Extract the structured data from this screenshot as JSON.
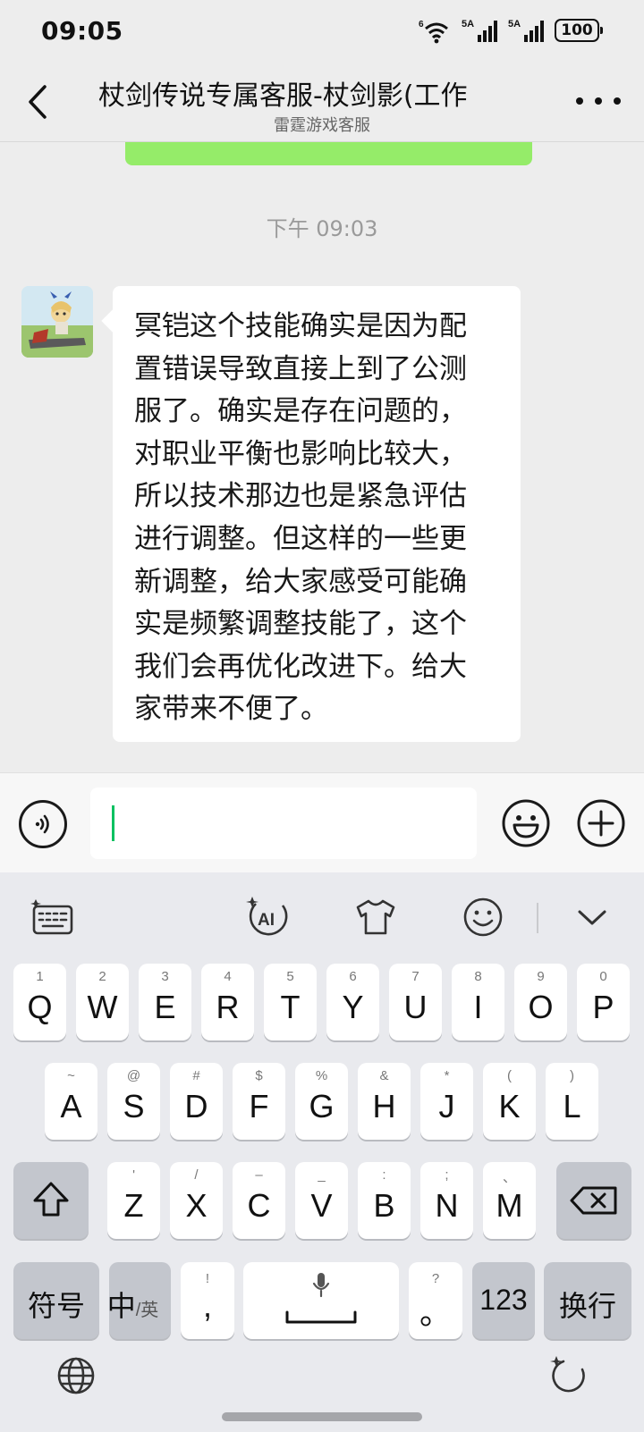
{
  "status_bar": {
    "time": "09:05",
    "wifi_label": "6",
    "sim1_label": "5A",
    "sim2_label": "5A",
    "battery": "100"
  },
  "header": {
    "title": "杖剑传说专属客服-杖剑影(工作",
    "subtitle": "雷霆游戏客服"
  },
  "chat": {
    "timestamp": "下午 09:03",
    "message": "冥铠这个技能确实是因为配\n置错误导致直接上到了公测\n服了。确实是存在问题的，\n对职业平衡也影响比较大，\n所以技术那边也是紧急评估\n进行调整。但这样的一些更\n新调整，给大家感受可能确\n实是频繁调整技能了，这个\n我们会再优化改进下。给大\n家带来不便了。"
  },
  "input": {
    "value": ""
  },
  "keyboard": {
    "toolbar": {
      "ai_label": "AI"
    },
    "row1": [
      {
        "sub": "1",
        "main": "Q"
      },
      {
        "sub": "2",
        "main": "W"
      },
      {
        "sub": "3",
        "main": "E"
      },
      {
        "sub": "4",
        "main": "R"
      },
      {
        "sub": "5",
        "main": "T"
      },
      {
        "sub": "6",
        "main": "Y"
      },
      {
        "sub": "7",
        "main": "U"
      },
      {
        "sub": "8",
        "main": "I"
      },
      {
        "sub": "9",
        "main": "O"
      },
      {
        "sub": "0",
        "main": "P"
      }
    ],
    "row2": [
      {
        "sub": "~",
        "main": "A"
      },
      {
        "sub": "@",
        "main": "S"
      },
      {
        "sub": "#",
        "main": "D"
      },
      {
        "sub": "$",
        "main": "F"
      },
      {
        "sub": "%",
        "main": "G"
      },
      {
        "sub": "&",
        "main": "H"
      },
      {
        "sub": "*",
        "main": "J"
      },
      {
        "sub": "(",
        "main": "K"
      },
      {
        "sub": ")",
        "main": "L"
      }
    ],
    "row3": [
      {
        "sub": "'",
        "main": "Z"
      },
      {
        "sub": "/",
        "main": "X"
      },
      {
        "sub": "–",
        "main": "C"
      },
      {
        "sub": "_",
        "main": "V"
      },
      {
        "sub": ":",
        "main": "B"
      },
      {
        "sub": ";",
        "main": "N"
      },
      {
        "sub": "、",
        "main": "M"
      }
    ],
    "symbols_label": "符号",
    "lang_main": "中",
    "lang_sub": "/英",
    "comma_sub": "!",
    "comma_main": ",",
    "period_sub": "?",
    "period_main": "。",
    "numbers_label": "123",
    "enter_label": "换行"
  }
}
